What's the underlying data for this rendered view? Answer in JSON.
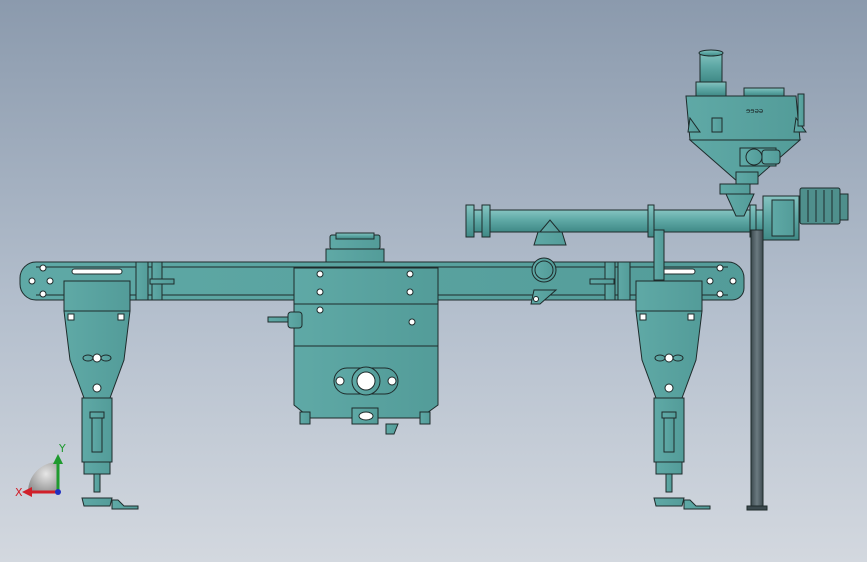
{
  "viewport": {
    "background_top": "#8b9aad",
    "background_bottom": "#d3d8df"
  },
  "model": {
    "body_color": "#5fa9a6",
    "body_light": "#86c4c1",
    "body_dark": "#3f8986",
    "edge_color": "#1e2b2b",
    "frame_color": "#3c4a4f",
    "motor_color": "#4f8f8c",
    "nameplate_text": "ɘɘəə"
  },
  "triad": {
    "x_label": "X",
    "y_label": "Y",
    "x_color": "#d0202a",
    "y_color": "#1f9a2f",
    "z_color": "#2030c0"
  }
}
